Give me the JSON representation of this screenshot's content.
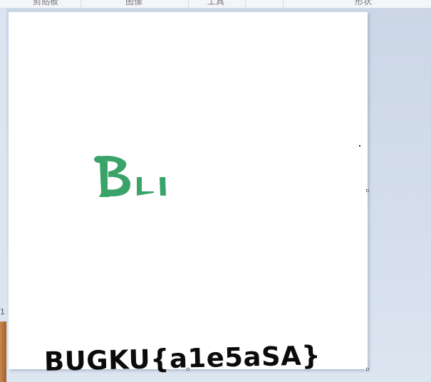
{
  "ribbon": {
    "groups": [
      "剪贴板",
      "图像",
      "工具",
      "形状"
    ]
  },
  "ruler": {
    "mark": "1"
  },
  "canvas": {
    "logo_text": "Bu",
    "logo_color": "#3aa36a",
    "flag_text": "BUGKU{a1e5aSA}"
  }
}
